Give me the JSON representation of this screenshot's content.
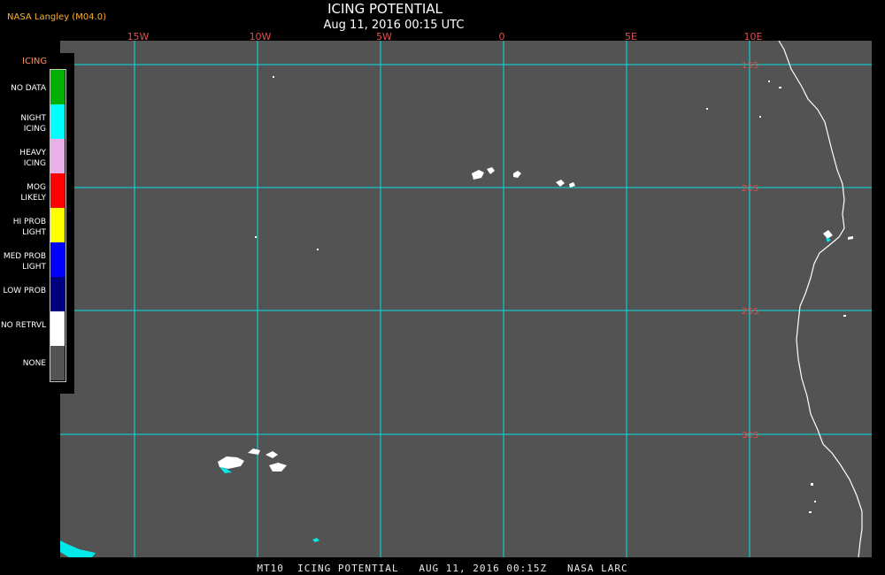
{
  "header": {
    "source": "NASA Langley (M04.0)",
    "title": "ICING POTENTIAL",
    "timestamp": "Aug 11, 2016 00:15 UTC"
  },
  "map": {
    "lon_labels": [
      "15W",
      "10W",
      "5W",
      "0",
      "5E",
      "10E"
    ],
    "lat_labels": [
      "15S",
      "20S",
      "25S",
      "30S"
    ],
    "gridline_color": "#00e0e0",
    "background_color": "#535353",
    "coastline_color": "#ffffff"
  },
  "legend": {
    "title": "ICING",
    "items": [
      {
        "label": "NO DATA",
        "color": "#00b000"
      },
      {
        "label": "NIGHT ICING",
        "color": "#00ffff"
      },
      {
        "label": "HEAVY ICING",
        "color": "#e8b0e8"
      },
      {
        "label": "MOG LIKELY",
        "color": "#ff0000"
      },
      {
        "label": "HI PROB LIGHT",
        "color": "#ffff00"
      },
      {
        "label": "MED PROB LIGHT",
        "color": "#0000ff"
      },
      {
        "label": "LOW PROB",
        "color": "#000080"
      },
      {
        "label": "NO RETRVL",
        "color": "#ffffff"
      },
      {
        "label": "NONE",
        "color": "#535353"
      }
    ]
  },
  "footer": "MT10  ICING POTENTIAL   AUG 11, 2016 00:15Z   NASA LARC"
}
